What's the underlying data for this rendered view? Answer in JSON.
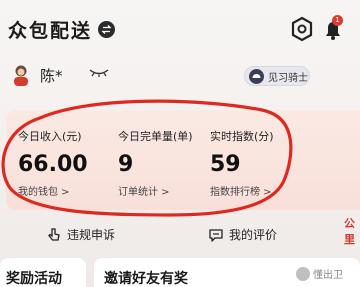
{
  "header": {
    "app_title": "众包配送",
    "notification_count": "1"
  },
  "user": {
    "name": "陈*",
    "badge_label": "见习骑士"
  },
  "stats": [
    {
      "label": "今日收入(元)",
      "value": "66.00",
      "link": "我的钱包 >"
    },
    {
      "label": "今日完单量(单)",
      "value": "9",
      "link": "订单统计 >"
    },
    {
      "label": "实时指数(分)",
      "value": "59",
      "link": "指数排行榜 >"
    }
  ],
  "side_text": "公里",
  "actions": {
    "complaint_label": "违规申诉",
    "review_label": "我的评价"
  },
  "cards": {
    "rewards_title": "奖励活动",
    "invite_title": "邀请好友有奖"
  },
  "watermark": "懂出卫",
  "colors": {
    "annotation_red": "#e0281e",
    "badge_red": "#e03a2e",
    "card_pink": "#fbe9e4"
  }
}
